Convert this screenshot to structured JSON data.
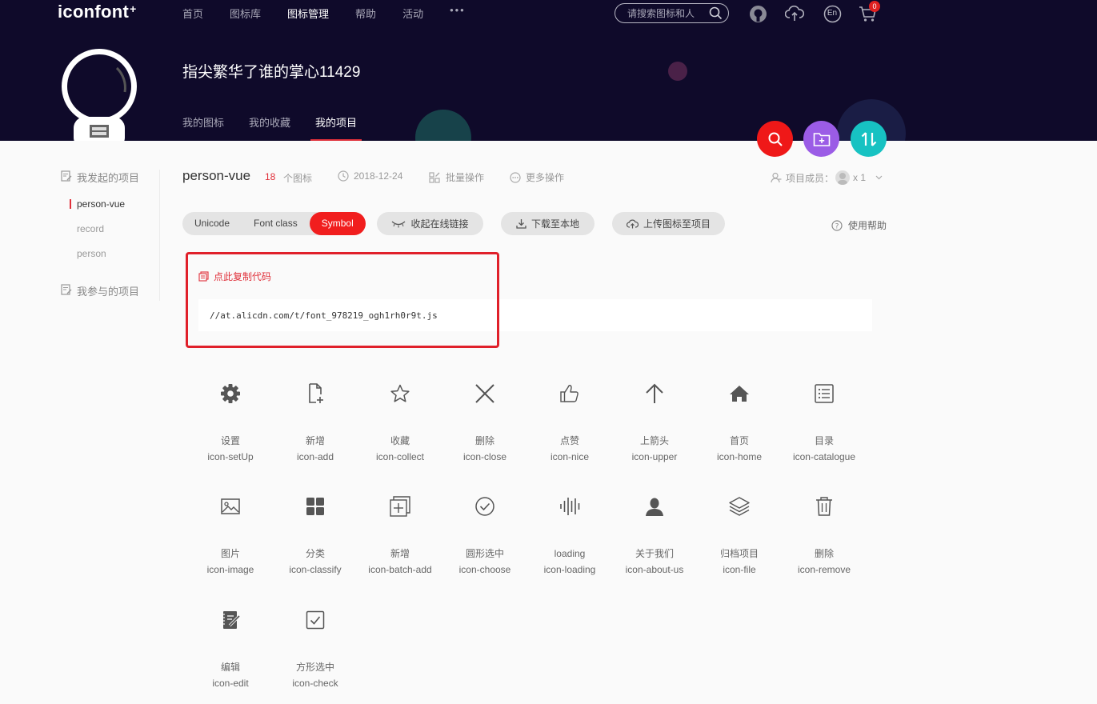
{
  "header": {
    "logo_text": "iconfont",
    "logo_sup": "+",
    "nav": [
      "首页",
      "图标库",
      "图标管理",
      "帮助",
      "活动"
    ],
    "nav_active_index": 2,
    "more_label": "•••",
    "search_placeholder": "请搜索图标和人",
    "cart_count": "0",
    "language_label": "En",
    "username": "指尖繁华了谁的掌心11429",
    "subtabs": [
      "我的图标",
      "我的收藏",
      "我的项目"
    ],
    "subtab_active_index": 2
  },
  "sidebar": {
    "initiated_label": "我发起的项目",
    "projects": [
      "person-vue",
      "record",
      "person"
    ],
    "active_project_index": 0,
    "joined_label": "我参与的项目"
  },
  "project": {
    "name": "person-vue",
    "icon_count": "18",
    "icon_count_unit": "个图标",
    "date": "2018-12-24",
    "batch_label": "批量操作",
    "more_label": "更多操作",
    "members_label": "项目成员：",
    "members_count": "x 1"
  },
  "toolbar": {
    "modes": [
      "Unicode",
      "Font class",
      "Symbol"
    ],
    "active_mode_index": 2,
    "collapse_label": "收起在线链接",
    "download_label": "下载至本地",
    "upload_label": "上传图标至项目",
    "help_label": "使用帮助"
  },
  "code": {
    "copy_label": "点此复制代码",
    "url": "//at.alicdn.com/t/font_978219_ogh1rh0r9t.js"
  },
  "icons": [
    {
      "cn": "设置",
      "en": "icon-setUp",
      "glyph": "gear-icon"
    },
    {
      "cn": "新增",
      "en": "icon-add",
      "glyph": "file-add-icon"
    },
    {
      "cn": "收藏",
      "en": "icon-collect",
      "glyph": "star-icon"
    },
    {
      "cn": "删除",
      "en": "icon-close",
      "glyph": "close-icon"
    },
    {
      "cn": "点赞",
      "en": "icon-nice",
      "glyph": "thumbs-up-icon"
    },
    {
      "cn": "上箭头",
      "en": "icon-upper",
      "glyph": "arrow-up-icon"
    },
    {
      "cn": "首页",
      "en": "icon-home",
      "glyph": "home-icon"
    },
    {
      "cn": "目录",
      "en": "icon-catalogue",
      "glyph": "list-icon"
    },
    {
      "cn": "图片",
      "en": "icon-image",
      "glyph": "image-icon"
    },
    {
      "cn": "分类",
      "en": "icon-classify",
      "glyph": "grid-icon"
    },
    {
      "cn": "新增",
      "en": "icon-batch-add",
      "glyph": "batch-add-icon"
    },
    {
      "cn": "圆形选中",
      "en": "icon-choose",
      "glyph": "check-circle-icon"
    },
    {
      "cn": "loading",
      "en": "icon-loading",
      "glyph": "loading-bars-icon"
    },
    {
      "cn": "关于我们",
      "en": "icon-about-us",
      "glyph": "user-icon"
    },
    {
      "cn": "归档项目",
      "en": "icon-file",
      "glyph": "layers-icon"
    },
    {
      "cn": "删除",
      "en": "icon-remove",
      "glyph": "trash-icon"
    },
    {
      "cn": "编辑",
      "en": "icon-edit",
      "glyph": "notebook-edit-icon"
    },
    {
      "cn": "方形选中",
      "en": "icon-check",
      "glyph": "check-square-icon"
    }
  ],
  "colors": {
    "header_bg": "#0f0a2a",
    "accent_red": "#f11e1e",
    "fab_purple": "#9b5ce6",
    "fab_teal": "#17c2c2"
  }
}
